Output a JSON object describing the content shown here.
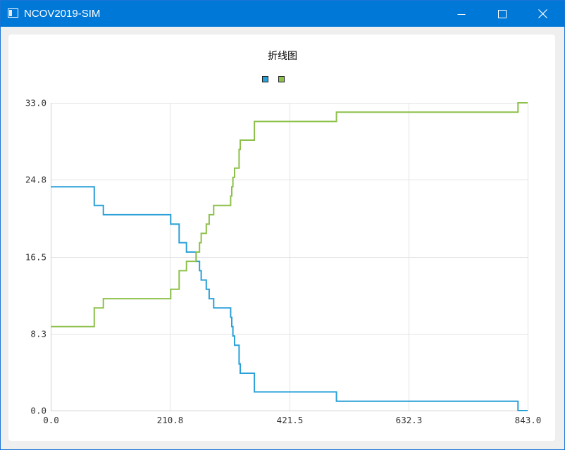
{
  "window": {
    "title": "NCOV2019-SIM"
  },
  "colors": {
    "titlebar": "#0078d7",
    "series_1": "#2aa0d8",
    "series_2": "#8dc04a",
    "grid": "#e3e3e3"
  },
  "icons": {
    "app": "window-app-icon",
    "minimize": "minimize-icon",
    "maximize": "maximize-icon",
    "close": "close-icon"
  },
  "chart_data": {
    "type": "line",
    "title": "折线图",
    "xlabel": "",
    "ylabel": "",
    "xlim": [
      0.0,
      843.0
    ],
    "ylim": [
      0.0,
      33.0
    ],
    "x_ticks": [
      "0.0",
      "210.8",
      "421.5",
      "632.3",
      "843.0"
    ],
    "y_ticks": [
      "33.0",
      "24.8",
      "16.5",
      "8.3",
      "0.0"
    ],
    "grid": true,
    "legend_placement": "top-center",
    "series": [
      {
        "color": "#2aa0d8",
        "step": true,
        "points": [
          [
            0,
            24
          ],
          [
            77,
            24
          ],
          [
            77,
            22
          ],
          [
            93,
            22
          ],
          [
            93,
            21
          ],
          [
            212,
            21
          ],
          [
            212,
            20
          ],
          [
            227,
            20
          ],
          [
            227,
            18
          ],
          [
            240,
            18
          ],
          [
            240,
            17
          ],
          [
            257,
            17
          ],
          [
            257,
            16
          ],
          [
            263,
            16
          ],
          [
            263,
            15
          ],
          [
            266,
            15
          ],
          [
            266,
            14
          ],
          [
            275,
            14
          ],
          [
            275,
            13
          ],
          [
            280,
            13
          ],
          [
            280,
            12
          ],
          [
            288,
            12
          ],
          [
            288,
            11
          ],
          [
            318,
            11
          ],
          [
            318,
            10
          ],
          [
            320,
            10
          ],
          [
            320,
            9
          ],
          [
            322,
            9
          ],
          [
            322,
            8
          ],
          [
            325,
            8
          ],
          [
            325,
            7
          ],
          [
            333,
            7
          ],
          [
            333,
            5
          ],
          [
            335,
            5
          ],
          [
            335,
            4
          ],
          [
            360,
            4
          ],
          [
            360,
            2
          ],
          [
            505,
            2
          ],
          [
            505,
            1
          ],
          [
            826,
            1
          ],
          [
            826,
            0
          ],
          [
            843,
            0
          ]
        ]
      },
      {
        "color": "#8dc04a",
        "step": true,
        "points": [
          [
            0,
            9
          ],
          [
            77,
            9
          ],
          [
            77,
            11
          ],
          [
            93,
            11
          ],
          [
            93,
            12
          ],
          [
            212,
            12
          ],
          [
            212,
            13
          ],
          [
            227,
            13
          ],
          [
            227,
            15
          ],
          [
            240,
            15
          ],
          [
            240,
            16
          ],
          [
            257,
            16
          ],
          [
            257,
            17
          ],
          [
            263,
            17
          ],
          [
            263,
            18
          ],
          [
            266,
            18
          ],
          [
            266,
            19
          ],
          [
            275,
            19
          ],
          [
            275,
            20
          ],
          [
            280,
            20
          ],
          [
            280,
            21
          ],
          [
            288,
            21
          ],
          [
            288,
            22
          ],
          [
            318,
            22
          ],
          [
            318,
            23
          ],
          [
            320,
            23
          ],
          [
            320,
            24
          ],
          [
            322,
            24
          ],
          [
            322,
            25
          ],
          [
            325,
            25
          ],
          [
            325,
            26
          ],
          [
            333,
            26
          ],
          [
            333,
            28
          ],
          [
            335,
            28
          ],
          [
            335,
            29
          ],
          [
            360,
            29
          ],
          [
            360,
            31
          ],
          [
            505,
            31
          ],
          [
            505,
            32
          ],
          [
            826,
            32
          ],
          [
            826,
            33
          ],
          [
            843,
            33
          ]
        ]
      }
    ]
  }
}
